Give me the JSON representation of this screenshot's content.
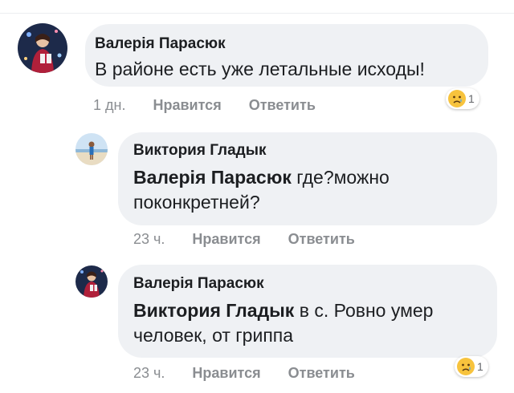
{
  "comments": [
    {
      "author": "Валерія Парасюк",
      "mention": "",
      "text": "В районе есть уже летальные исходы!",
      "time": "1 дн.",
      "like_label": "Нравится",
      "reply_label": "Ответить",
      "reaction_icon": "sad-face-icon",
      "reaction_count": "1"
    },
    {
      "author": "Виктория Гладык",
      "mention": "Валерія Парасюк",
      "text_line1": " где?можно",
      "text_line2": "поконкретней?",
      "time": "23 ч.",
      "like_label": "Нравится",
      "reply_label": "Ответить"
    },
    {
      "author": "Валерія Парасюк",
      "mention": "Виктория Гладык",
      "text_line1": " в с. Ровно умер",
      "text_line2": "человек, от гриппа",
      "time": "23 ч.",
      "like_label": "Нравится",
      "reply_label": "Ответить",
      "reaction_icon": "sad-face-icon",
      "reaction_count": "1"
    }
  ],
  "colors": {
    "bubble": "#eff1f4",
    "text": "#1c1e21",
    "meta": "#8a8d91"
  }
}
